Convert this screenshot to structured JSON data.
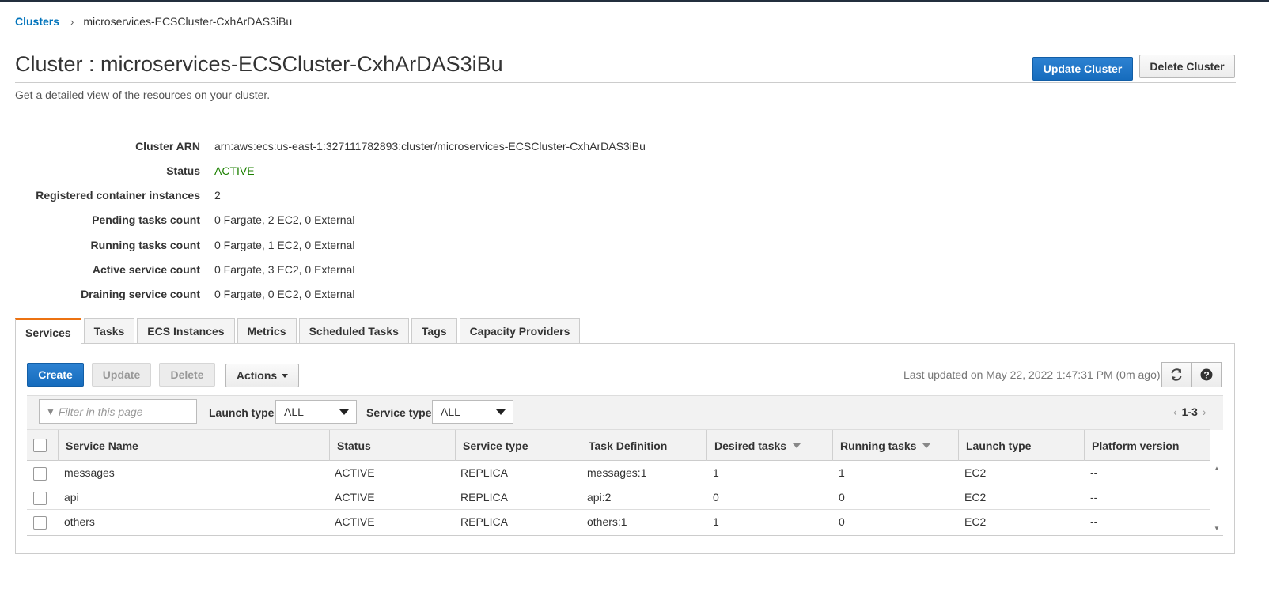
{
  "breadcrumb": {
    "root": "Clusters",
    "separator": "›",
    "current": "microservices-ECSCluster-CxhArDAS3iBu"
  },
  "header": {
    "title": "Cluster : microservices-ECSCluster-CxhArDAS3iBu",
    "subtitle": "Get a detailed view of the resources on your cluster.",
    "update_button": "Update Cluster",
    "delete_button": "Delete Cluster"
  },
  "details": [
    {
      "label": "Cluster ARN",
      "value": "arn:aws:ecs:us-east-1:327111782893:cluster/microservices-ECSCluster-CxhArDAS3iBu"
    },
    {
      "label": "Status",
      "value": "ACTIVE"
    },
    {
      "label": "Registered container instances",
      "value": "2"
    },
    {
      "label": "Pending tasks count",
      "value": "0 Fargate, 2 EC2, 0 External"
    },
    {
      "label": "Running tasks count",
      "value": "0 Fargate, 1 EC2, 0 External"
    },
    {
      "label": "Active service count",
      "value": "0 Fargate, 3 EC2, 0 External"
    },
    {
      "label": "Draining service count",
      "value": "0 Fargate, 0 EC2, 0 External"
    }
  ],
  "tabs": [
    "Services",
    "Tasks",
    "ECS Instances",
    "Metrics",
    "Scheduled Tasks",
    "Tags",
    "Capacity Providers"
  ],
  "active_tab": "Services",
  "toolbar": {
    "create": "Create",
    "update": "Update",
    "delete": "Delete",
    "actions": "Actions",
    "last_updated": "Last updated on May 22, 2022 1:47:31 PM (0m ago)",
    "refresh_icon": "refresh-icon",
    "help_icon": "help-icon"
  },
  "filters": {
    "search_placeholder": "Filter in this page",
    "launch_type_label": "Launch type",
    "launch_type_value": "ALL",
    "service_type_label": "Service type",
    "service_type_value": "ALL",
    "pager_range": "1-3"
  },
  "table": {
    "columns": [
      "Service Name",
      "Status",
      "Service type",
      "Task Definition",
      "Desired tasks",
      "Running tasks",
      "Launch type",
      "Platform version"
    ],
    "rows": [
      [
        "messages",
        "ACTIVE",
        "REPLICA",
        "messages:1",
        "1",
        "1",
        "EC2",
        "--"
      ],
      [
        "api",
        "ACTIVE",
        "REPLICA",
        "api:2",
        "0",
        "0",
        "EC2",
        "--"
      ],
      [
        "others",
        "ACTIVE",
        "REPLICA",
        "others:1",
        "1",
        "0",
        "EC2",
        "--"
      ]
    ]
  },
  "colors": {
    "link": "#0073bb",
    "active_status": "#1d8102",
    "primary_button": "#1a73c9",
    "active_tab_accent": "#ec7211"
  }
}
